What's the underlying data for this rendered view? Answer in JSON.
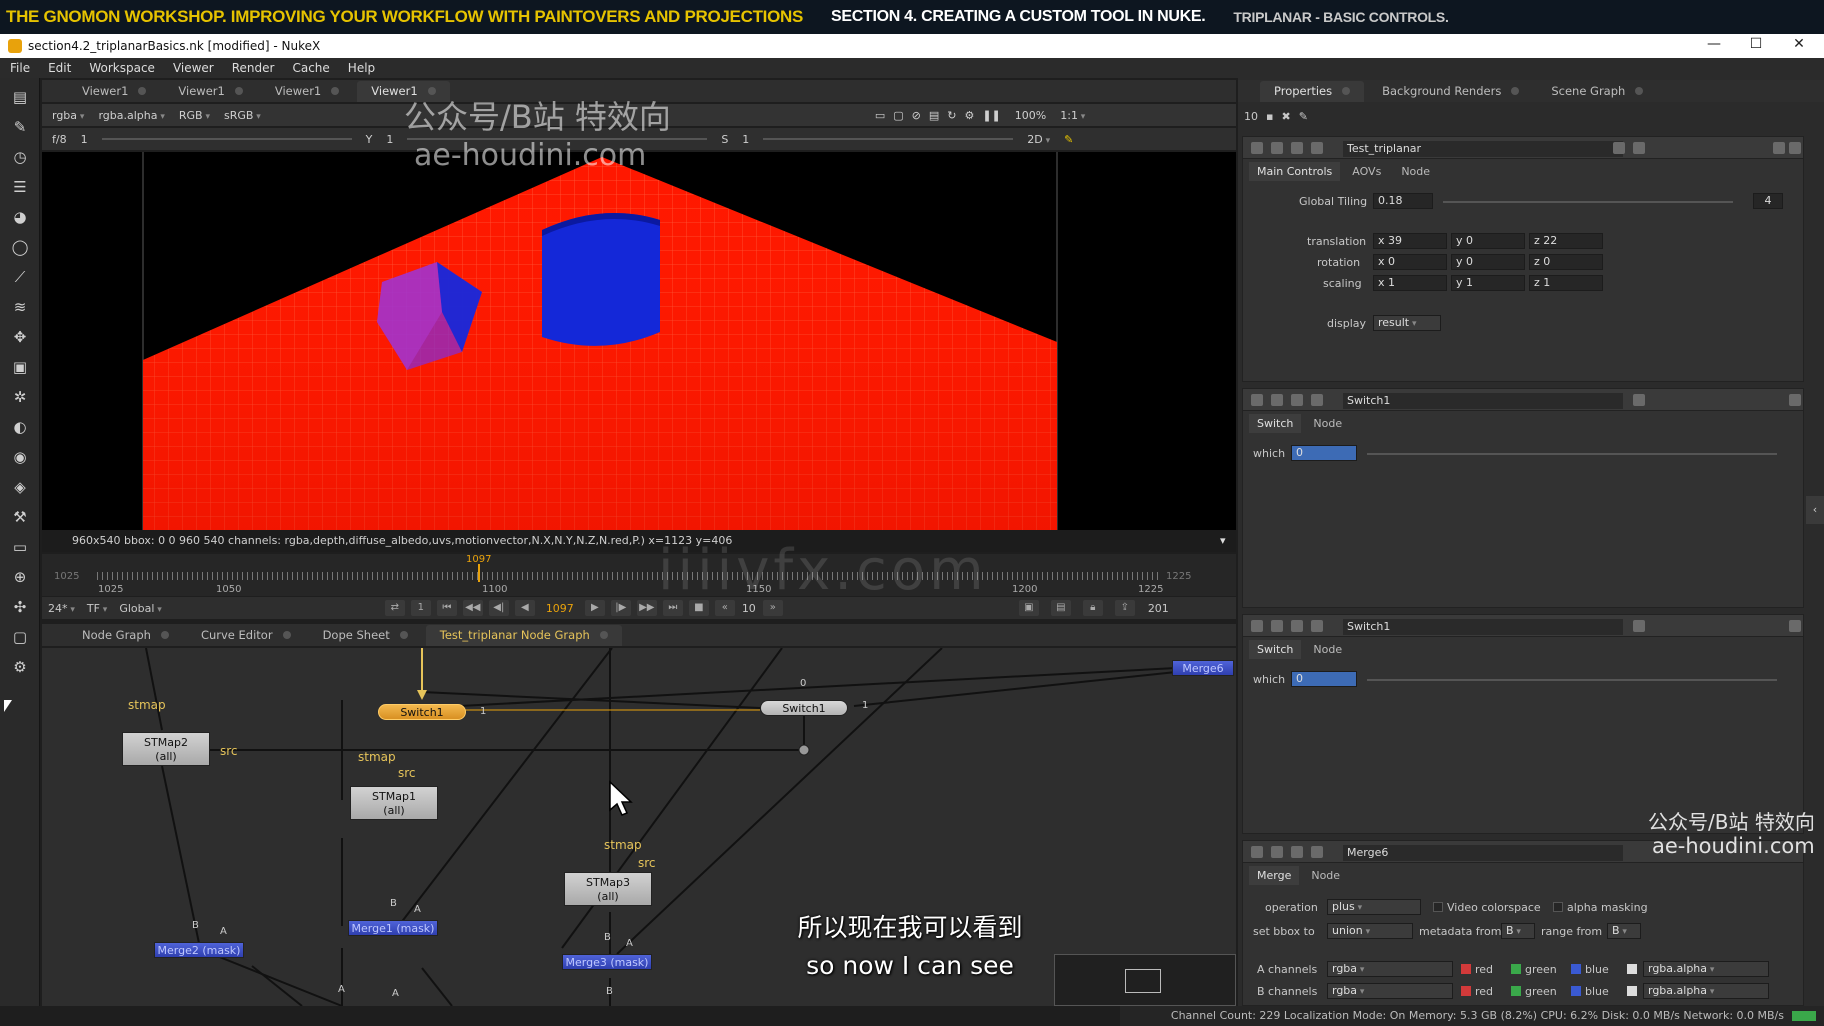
{
  "banner": {
    "course": "THE GNOMON WORKSHOP. IMPROVING YOUR WORKFLOW WITH PAINTOVERS AND PROJECTIONS",
    "section": "SECTION 4. CREATING A CUSTOM TOOL IN NUKE.",
    "lesson": "TRIPLANAR - BASIC CONTROLS."
  },
  "window": {
    "title": "section4.2_triplanarBasics.nk [modified] - NukeX",
    "minimize": "—",
    "maximize": "☐",
    "close": "✕"
  },
  "menu": [
    "File",
    "Edit",
    "Workspace",
    "Viewer",
    "Render",
    "Cache",
    "Help"
  ],
  "viewer": {
    "tabs": [
      "Viewer1",
      "Viewer1",
      "Viewer1",
      "Viewer1"
    ],
    "channels": "rgba",
    "alpha": "rgba.alpha",
    "rgb": "RGB",
    "colorspace": "sRGB",
    "fstop": "f/8",
    "frame_field": "1",
    "y_label": "Y",
    "y_value": "1",
    "s_label": "S",
    "s_value": "1",
    "view_mode": "2D",
    "zoom": "100%",
    "ratio": "1:1",
    "info": "960x540  bbox: 0 0 960 540 channels: rgba,depth,diffuse_albedo,uvs,motionvector,N.X,N.Y,N.Z,N.red,P.)  x=1123 y=406"
  },
  "timeline": {
    "start_dim": "1025",
    "end_dim": "1225",
    "current": "1097",
    "labels": [
      "1025",
      "1050",
      "1100",
      "1150",
      "1200",
      "1225"
    ],
    "fps": "24*",
    "tf": "TF",
    "global": "Global",
    "frame": "1097",
    "step": "10",
    "end_frame": "201",
    "inc": "1"
  },
  "nodegraph": {
    "tabs": [
      "Node Graph",
      "Curve Editor",
      "Dope Sheet",
      "Test_triplanar Node Graph"
    ],
    "nodes": {
      "stmap2": [
        "STMap2",
        "(all)"
      ],
      "stmap1": [
        "STMap1",
        "(all)"
      ],
      "stmap3": [
        "STMap3",
        "(all)"
      ],
      "switch1a": "Switch1",
      "switch1b": "Switch1",
      "merge2": "Merge2 (mask)",
      "merge1": "Merge1 (mask)",
      "merge3": "Merge3 (mask)",
      "merge_right": "Merge6"
    },
    "labels": {
      "stmap": "stmap",
      "src": "src",
      "a": "A",
      "b": "B",
      "one": "1",
      "zero": "0"
    }
  },
  "properties": {
    "tabs": [
      "Properties",
      "Background Renders",
      "Scene Graph"
    ],
    "count": "10",
    "test_triplanar": {
      "name": "Test_triplanar",
      "tabs": [
        "Main Controls",
        "AOVs",
        "Node"
      ],
      "global_tiling_label": "Global Tiling",
      "global_tiling": "0.18",
      "translation_label": "translation",
      "translation": [
        "x 39",
        "y 0",
        "z 22"
      ],
      "rotation_label": "rotation",
      "rotation": [
        "x 0",
        "y 0",
        "z 0"
      ],
      "scaling_label": "scaling",
      "scaling": [
        "x 1",
        "y 1",
        "z 1"
      ],
      "display_label": "display",
      "display": "result",
      "badge": "4"
    },
    "switch_a": {
      "name": "Switch1",
      "tabs": [
        "Switch",
        "Node"
      ],
      "which_label": "which",
      "which": "0"
    },
    "switch_b": {
      "name": "Switch1",
      "tabs": [
        "Switch",
        "Node"
      ],
      "which_label": "which",
      "which": "0"
    },
    "merge6": {
      "name": "Merge6",
      "tabs": [
        "Merge",
        "Node"
      ],
      "operation_label": "operation",
      "operation": "plus",
      "video_colorspace": "Video colorspace",
      "alpha_masking": "alpha masking",
      "bbox_label": "set bbox to",
      "bbox": "union",
      "metadata_label": "metadata from",
      "metadata": "B",
      "range_label": "range from",
      "range": "B",
      "a_channels_label": "A channels",
      "a_channels": "rgba",
      "b_channels_label": "B channels",
      "b_channels": "rgba",
      "ch_red": "red",
      "ch_green": "green",
      "ch_blue": "blue",
      "ch_alpha": "rgba.alpha"
    }
  },
  "status": "Channel Count: 229  Localization Mode: On  Memory: 5.3 GB (8.2%)  CPU: 6.2%  Disk: 0.0 MB/s  Network: 0.0 MB/s",
  "watermarks": {
    "top_cn": "公众号/B站 特效向",
    "top_url": "ae-houdini.com",
    "center": "iiiivfx.com",
    "br_cn": "公众号/B站 特效向",
    "br_url": "ae-houdini.com"
  },
  "subtitles": {
    "cn": "所以现在我可以看到",
    "en": "so now I can see"
  },
  "colors": {
    "accent": "#e8a20c",
    "floor": "#ff1a00",
    "object": "#1428d8",
    "merge_node": "#3b4fcc",
    "switch_selected": "#e9a23a"
  }
}
